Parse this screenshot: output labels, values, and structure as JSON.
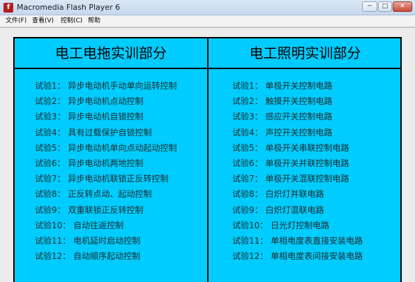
{
  "window": {
    "title": "Macromedia Flash Player 6",
    "icon_label": "f",
    "min_glyph": "─",
    "max_glyph": "□",
    "close_glyph": "✕"
  },
  "menu": {
    "items": [
      {
        "label": "文件(F)"
      },
      {
        "label": "查看(V)"
      },
      {
        "label": "控制(C)"
      },
      {
        "label": "帮助"
      }
    ]
  },
  "panel": {
    "background": "#00ccff",
    "left": {
      "title": "电工电拖实训部分",
      "items": [
        "试验1：  异步电动机手动单向运转控制",
        "试验2：  异步电动机点动控制",
        "试验3：  异步电动机自锁控制",
        "试验4：  具有过载保护自锁控制",
        "试验5：  异步电动机单向点动起动控制",
        "试验6：  异步电动机两地控制",
        "试验7：  异步电动机联锁正反转控制",
        "试验8：  正反转点动、起动控制",
        "试验9：  双重联锁正反转控制",
        "试验10：  自动往返控制",
        "试验11：  电机延时启动控制",
        "试验12：  自动顺序起动控制"
      ]
    },
    "right": {
      "title": "电工照明实训部分",
      "items": [
        "试验1：  单极开关控制电路",
        "试验2：  触摸开关控制电路",
        "试验3：  感应开关控制电路",
        "试验4：  声控开关控制电路",
        "试验5：  单极开关串联控制电路",
        "试验6：  单极开关并联控制电路",
        "试验7：  单极开关混联控制电路",
        "试验8：  白炽灯并联电路",
        "试验9：  白炽灯混联电路",
        "试验10：  日光灯控制电路",
        "试验11：  单相电度表直接安装电路",
        "试验12：  单相电度表间接安装电路"
      ]
    }
  }
}
